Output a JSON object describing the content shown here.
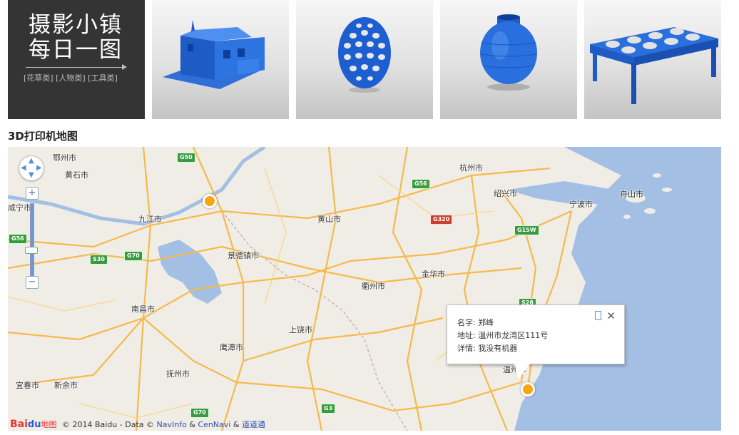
{
  "banner": {
    "line1": "摄影小镇",
    "line2": "每日一图",
    "categories": "[花草类] [人物类] [工具类]"
  },
  "thumbnails": [
    {
      "name": "house-model"
    },
    {
      "name": "lattice-egg-model"
    },
    {
      "name": "vase-model"
    },
    {
      "name": "egg-tray-model"
    }
  ],
  "section_title": "3D打印机地图",
  "map": {
    "cities": {
      "ezhou": "鄂州市",
      "huangshi": "黄石市",
      "xianning": "咸宁市",
      "jiujiang": "九江市",
      "huangshan": "黄山市",
      "jingdezhen": "景德镇市",
      "hangzhou": "杭州市",
      "shaoxing": "绍兴市",
      "ningbo": "宁波市",
      "zhoushan": "舟山市",
      "jinhua": "金华市",
      "quzhou": "衢州市",
      "nanchang": "南昌市",
      "shangrao": "上饶市",
      "yingtan": "鹰潭市",
      "fuzhou": "抚州市",
      "yichun": "宜春市",
      "xinyu": "新余市",
      "wenzhou": "温州市"
    },
    "highways": {
      "g50": "G50",
      "g56_left": "G56",
      "g56": "G56",
      "g320": "G320",
      "g15w": "G15W",
      "s30": "S30",
      "g70_top": "G70",
      "g70_bottom": "G70",
      "s28": "S28",
      "g3": "G3"
    },
    "popup": {
      "name_label": "名字:",
      "name_value": "郑峰",
      "address_label": "地址:",
      "address_value": "温州市龙湾区111号",
      "details_label": "详情:",
      "details_value": "我没有机器",
      "close": "✕"
    },
    "zoom": {
      "plus": "+",
      "minus": "−"
    },
    "copyright": {
      "logo_bai": "Bai",
      "logo_paw": "du",
      "logo_map": "地图",
      "text": "© 2014 Baidu - Data ©",
      "navinfo": "NavInfo",
      "amp1": "&",
      "cennavi": "CenNavi",
      "amp2": "&",
      "daodao": "道道通"
    },
    "colors": {
      "land": "#f0ede6",
      "water": "#a3c0e4",
      "road": "#f6b94a",
      "marker": "#f8a60f"
    }
  }
}
